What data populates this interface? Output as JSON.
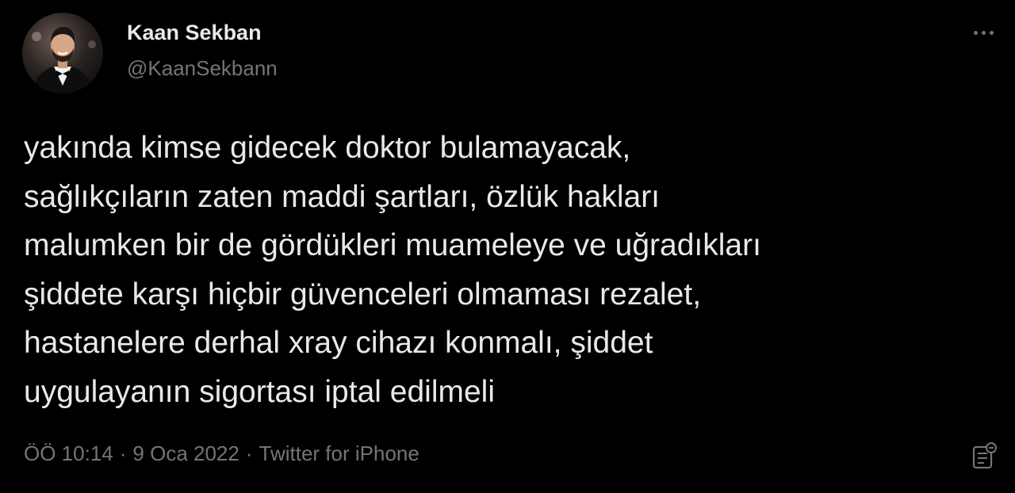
{
  "author": {
    "display_name": "Kaan Sekban",
    "handle": "@KaanSekbann"
  },
  "tweet": {
    "text": "yakında kimse gidecek doktor bulamayacak,\nsağlıkçıların zaten maddi şartları, özlük hakları\nmalumken bir de gördükleri muameleye ve uğradıkları\nşiddete karşı hiçbir güvenceleri olmaması rezalet,\nhastanelere derhal xray cihazı konmalı, şiddet\nuygulayanın sigortası iptal edilmeli",
    "time": "ÖÖ 10:14",
    "date": "9 Oca 2022",
    "source": "Twitter for iPhone",
    "separator": "·"
  },
  "icons": {
    "more": "more-horizontal-icon",
    "analytics": "analytics-icon"
  },
  "colors": {
    "background": "#000000",
    "primary_text": "#e7e9ea",
    "secondary_text": "#71767b"
  }
}
